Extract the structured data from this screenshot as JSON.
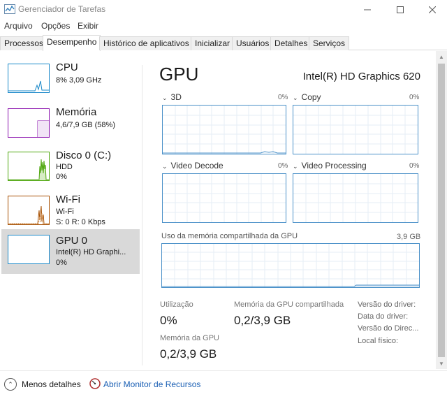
{
  "window": {
    "title": "Gerenciador de Tarefas"
  },
  "menu": {
    "items": [
      "Arquivo",
      "Opções",
      "Exibir"
    ]
  },
  "tabs": [
    "Processos",
    "Desempenho",
    "Histórico de aplicativos",
    "Inicializar",
    "Usuários",
    "Detalhes",
    "Serviços"
  ],
  "active_tab": "Desempenho",
  "sidebar": {
    "items": [
      {
        "title": "CPU",
        "line1": "8% 3,09 GHz",
        "line2": "",
        "color": "#1a88c9"
      },
      {
        "title": "Memória",
        "line1": "4,6/7,9 GB (58%)",
        "line2": "",
        "color": "#8b12ae"
      },
      {
        "title": "Disco 0 (C:)",
        "line1": "HDD",
        "line2": "0%",
        "color": "#4da60c"
      },
      {
        "title": "Wi-Fi",
        "line1": "Wi-Fi",
        "line2": "S: 0 R: 0 Kbps",
        "color": "#a74f01"
      },
      {
        "title": "GPU 0",
        "line1": "Intel(R) HD Graphi...",
        "line2": "0%",
        "color": "#1a88c9"
      }
    ]
  },
  "gpu": {
    "title": "GPU",
    "model": "Intel(R) HD Graphics 620",
    "engines": [
      {
        "name": "3D",
        "pct": "0%"
      },
      {
        "name": "Copy",
        "pct": "0%"
      },
      {
        "name": "Video Decode",
        "pct": "0%"
      },
      {
        "name": "Video Processing",
        "pct": "0%"
      }
    ],
    "shared_memory": {
      "label": "Uso da memória compartilhada da GPU",
      "max": "3,9 GB"
    },
    "stats": {
      "utilization_label": "Utilização",
      "utilization_value": "0%",
      "shared_label": "Memória da GPU compartilhada",
      "shared_value": "0,2/3,9 GB",
      "gpu_mem_label": "Memória da GPU",
      "gpu_mem_value": "0,2/3,9 GB"
    },
    "info_labels": [
      "Versão do driver:",
      "Data do driver:",
      "Versão do Direc...",
      "Local físico:"
    ],
    "graph_color": "#4a90c8"
  },
  "footer": {
    "fewer_details": "Menos detalhes",
    "resource_monitor": "Abrir Monitor de Recursos"
  }
}
